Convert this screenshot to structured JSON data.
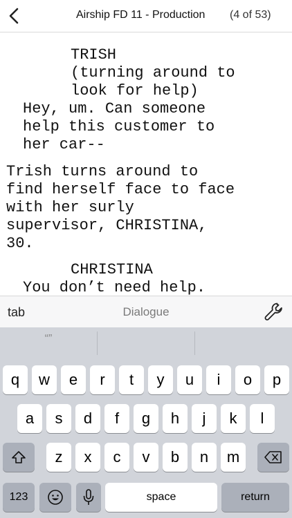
{
  "nav": {
    "title": "Airship FD 11 - Production",
    "count": "(4 of 53)"
  },
  "script_lines": [
    "TRISH",
    "(turning around to",
    "look for help)",
    "Hey, um. Can someone",
    "help this customer to",
    "her car--",
    "Trish turns around to",
    "find herself face to face",
    "with her surly",
    "supervisor, CHRISTINA,",
    "30.",
    "CHRISTINA",
    "You don’t need help."
  ],
  "accessory": {
    "tab_label": "tab",
    "element_type": "Dialogue"
  },
  "keyboard": {
    "prediction": "“”",
    "row1": [
      "q",
      "w",
      "e",
      "r",
      "t",
      "y",
      "u",
      "i",
      "o",
      "p"
    ],
    "row2": [
      "a",
      "s",
      "d",
      "f",
      "g",
      "h",
      "j",
      "k",
      "l"
    ],
    "row3": [
      "z",
      "x",
      "c",
      "v",
      "b",
      "n",
      "m"
    ],
    "numbers_label": "123",
    "space_label": "space",
    "return_label": "return"
  },
  "colors": {
    "keyboard_bg": "#d1d4da",
    "key_bg": "#ffffff",
    "dark_key_bg": "#abb0ba"
  },
  "icons": {
    "back": "chevron-left-icon",
    "wrench": "wrench-icon",
    "shift": "shift-icon",
    "delete": "backspace-icon",
    "emoji": "emoji-icon",
    "mic": "microphone-icon"
  }
}
